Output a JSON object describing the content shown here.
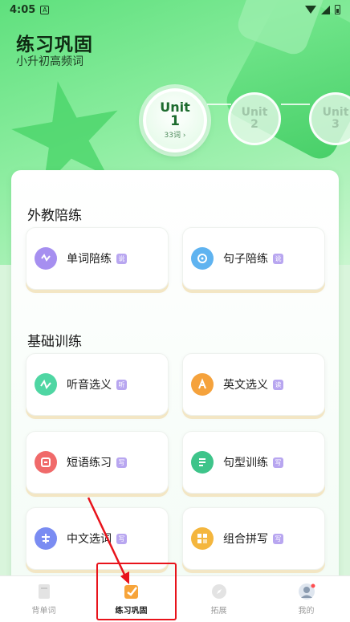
{
  "status_bar": {
    "time": "4:05",
    "notif_icon_letter": "A"
  },
  "header": {
    "title": "练习巩固",
    "subtitle": "小升初高频词"
  },
  "units": [
    {
      "label": "Unit",
      "number": "1",
      "count": "33词 ›"
    },
    {
      "label": "Unit",
      "number": "2"
    },
    {
      "label": "Unit",
      "number": "3"
    }
  ],
  "sections": {
    "foreign_teacher": {
      "title": "外教陪练",
      "tiles": [
        {
          "label": "单词陪练",
          "badge": "说",
          "icon": "word-practice-icon"
        },
        {
          "label": "句子陪练",
          "badge": "说",
          "icon": "sentence-practice-icon"
        }
      ]
    },
    "basic_training": {
      "title": "基础训练",
      "tiles": [
        {
          "label": "听音选义",
          "badge": "听",
          "icon": "listen-choose-icon"
        },
        {
          "label": "英文选义",
          "badge": "读",
          "icon": "english-choose-icon"
        },
        {
          "label": "短语练习",
          "badge": "写",
          "icon": "phrase-practice-icon"
        },
        {
          "label": "句型训练",
          "badge": "写",
          "icon": "sentence-pattern-icon"
        },
        {
          "label": "中文选词",
          "badge": "写",
          "icon": "chinese-choose-icon"
        },
        {
          "label": "组合拼写",
          "badge": "写",
          "icon": "combine-spell-icon"
        }
      ]
    }
  },
  "bottom_nav": [
    {
      "label": "背单词",
      "icon": "book-icon"
    },
    {
      "label": "练习巩固",
      "icon": "practice-icon",
      "active": true
    },
    {
      "label": "拓展",
      "icon": "compass-icon"
    },
    {
      "label": "我的",
      "icon": "avatar-icon"
    }
  ],
  "colors": {
    "accent_green": "#36c95a",
    "highlight_red": "#e8131b",
    "badge_purple": "#b8a6f0",
    "badge_green": "#8fd3a0"
  }
}
